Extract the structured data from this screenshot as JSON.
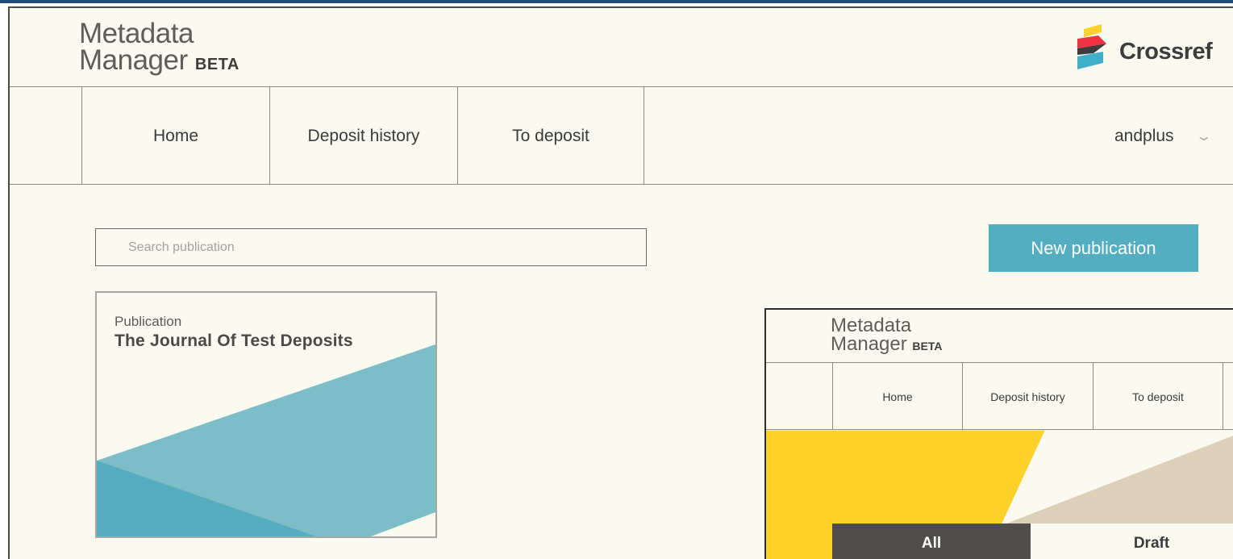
{
  "header": {
    "app_title_line1": "Metadata",
    "app_title_line2": "Manager",
    "beta": "BETA",
    "brand": "Crossref"
  },
  "nav": {
    "items": [
      {
        "label": "Home"
      },
      {
        "label": "Deposit history"
      },
      {
        "label": "To deposit"
      }
    ],
    "user": "andplus"
  },
  "search": {
    "placeholder": "Search publication",
    "value": ""
  },
  "actions": {
    "new_publication": "New publication"
  },
  "publications": [
    {
      "caption": "Publication",
      "title": "The Journal Of Test Deposits"
    }
  ],
  "inset": {
    "app_title_line1": "Metadata",
    "app_title_line2": "Manager",
    "beta": "BETA",
    "nav": [
      {
        "label": "Home"
      },
      {
        "label": "Deposit history"
      },
      {
        "label": "To deposit"
      }
    ],
    "tabs": [
      {
        "label": "All",
        "active": true
      },
      {
        "label": "Draft",
        "active": false
      }
    ]
  },
  "colors": {
    "accent": "#54aec1",
    "background": "#fbfaf1",
    "card_teal_light": "#7dbdc7",
    "card_teal_dark": "#57adc0",
    "banner_yellow": "#fcd12a",
    "banner_tan": "#dcd1b8",
    "tab_active": "#4f4e4b",
    "brand_yellow": "#fcd12a",
    "brand_red": "#ef3340",
    "brand_gray": "#3c3c3c",
    "brand_teal": "#3eb1c8"
  }
}
